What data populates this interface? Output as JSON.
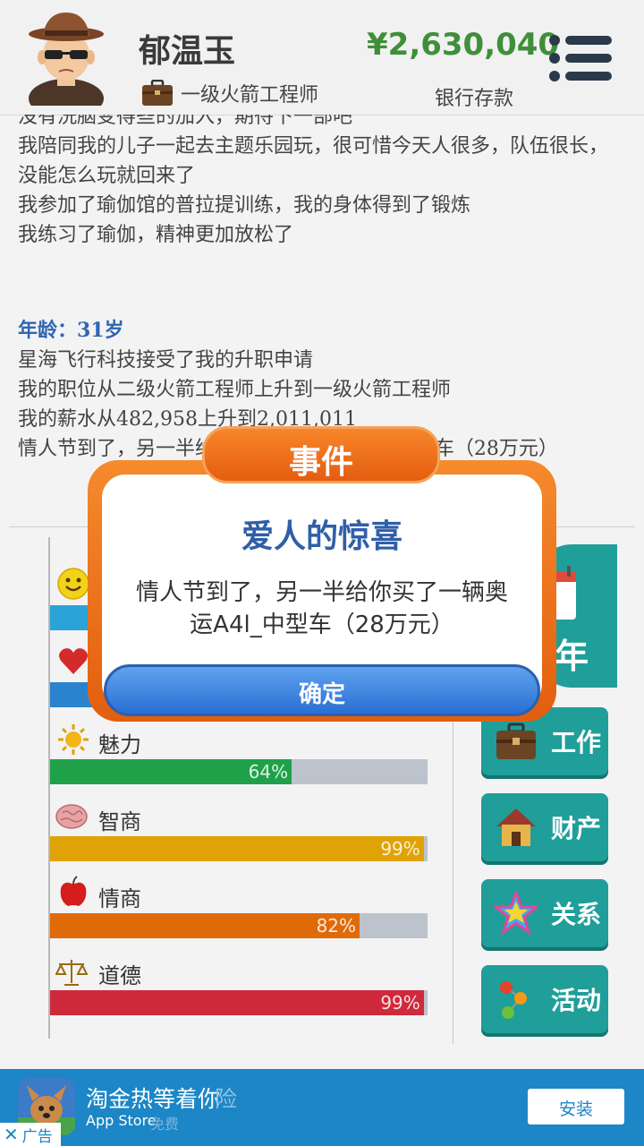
{
  "header": {
    "name": "郁温玉",
    "job_title": "一级火箭工程师",
    "money": "¥2,630,040",
    "money_label": "银行存款"
  },
  "log": {
    "lines_before": [
      "没有洗脑变得些的加入，期待下一部吧",
      "我陪同我的儿子一起去主题乐园玩，很可惜今天人很多，队伍很长，没能怎么玩就回来了",
      "我参加了瑜伽馆的普拉提训练，我的身体得到了锻炼",
      "我练习了瑜伽，精神更加放松了"
    ],
    "age_heading": "年龄：31岁",
    "lines_after": [
      "星海飞行科技接受了我的升职申请",
      "我的职位从二级火箭工程师上升到一级火箭工程师",
      "我的薪水从482,958上升到2,011,011",
      "情人节到了，另一半给你买了一辆奥运A4l_中型车（28万元）"
    ]
  },
  "stats": [
    {
      "label": "快乐",
      "percent": "",
      "value": 1.0,
      "color": "#2aa3d8"
    },
    {
      "label": "健康",
      "percent": "",
      "value": 1.0,
      "color": "#2a83cc"
    },
    {
      "label": "魅力",
      "percent": "64%",
      "value": 0.64,
      "color": "#1fa14a"
    },
    {
      "label": "智商",
      "percent": "99%",
      "value": 0.99,
      "color": "#e0a305"
    },
    {
      "label": "情商",
      "percent": "82%",
      "value": 0.82,
      "color": "#e06a08"
    },
    {
      "label": "道德",
      "percent": "99%",
      "value": 0.99,
      "color": "#cf2a3c"
    }
  ],
  "side_buttons": {
    "next_year": "年",
    "work": "工作",
    "property": "财产",
    "relations": "关系",
    "activities": "活动"
  },
  "dialog": {
    "tab_title": "事件",
    "heading": "爱人的惊喜",
    "message": "情人节到了，另一半给你买了一辆奥运A4l_中型车（28万元）",
    "confirm": "确定"
  },
  "ad": {
    "title": "淘金热等着你",
    "ghost_text": "险",
    "subtitle": "App Store",
    "ghost_sub": "免费",
    "install": "安装",
    "close_label": "广告"
  },
  "colors": {
    "teal": "#1f9e9a",
    "orange": "#f07a20",
    "blue_heading": "#2f66b3",
    "money_green": "#3f8f3a",
    "ad_blue": "#1c86c6"
  }
}
